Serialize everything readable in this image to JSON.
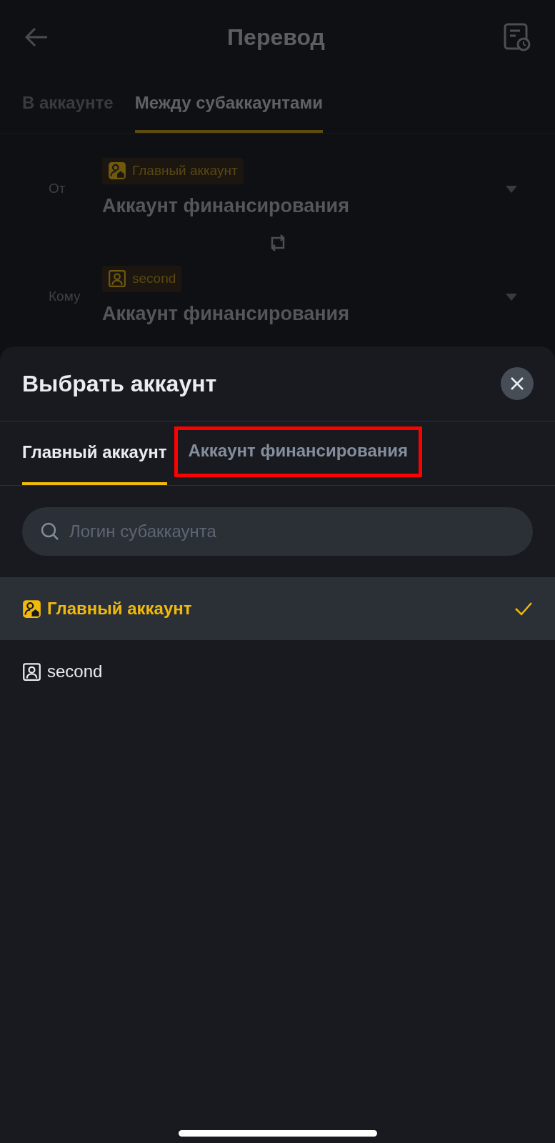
{
  "header": {
    "title": "Перевод"
  },
  "tabs": [
    {
      "label": "В аккаунте",
      "selected": false
    },
    {
      "label": "Между субаккаунтами",
      "selected": true
    }
  ],
  "transfer": [
    {
      "label": "От",
      "tag": {
        "kind": "main",
        "text": "Главный аккаунт"
      },
      "value": "Аккаунт финансирования"
    },
    {
      "label": "Кому",
      "tag": {
        "kind": "sub",
        "text": "second"
      },
      "value": "Аккаунт финансирования"
    }
  ],
  "sheet": {
    "title": "Выбрать аккаунт",
    "tabs": [
      {
        "label": "Главный аккаунт",
        "selected": true,
        "highlighted": false
      },
      {
        "label": "Аккаунт финансирования",
        "selected": false,
        "highlighted": true
      }
    ],
    "search": {
      "placeholder": "Логин субаккаунта"
    },
    "accounts": [
      {
        "kind": "main",
        "name": "Главный аккаунт",
        "selected": true
      },
      {
        "kind": "sub",
        "name": "second",
        "selected": false
      }
    ]
  }
}
